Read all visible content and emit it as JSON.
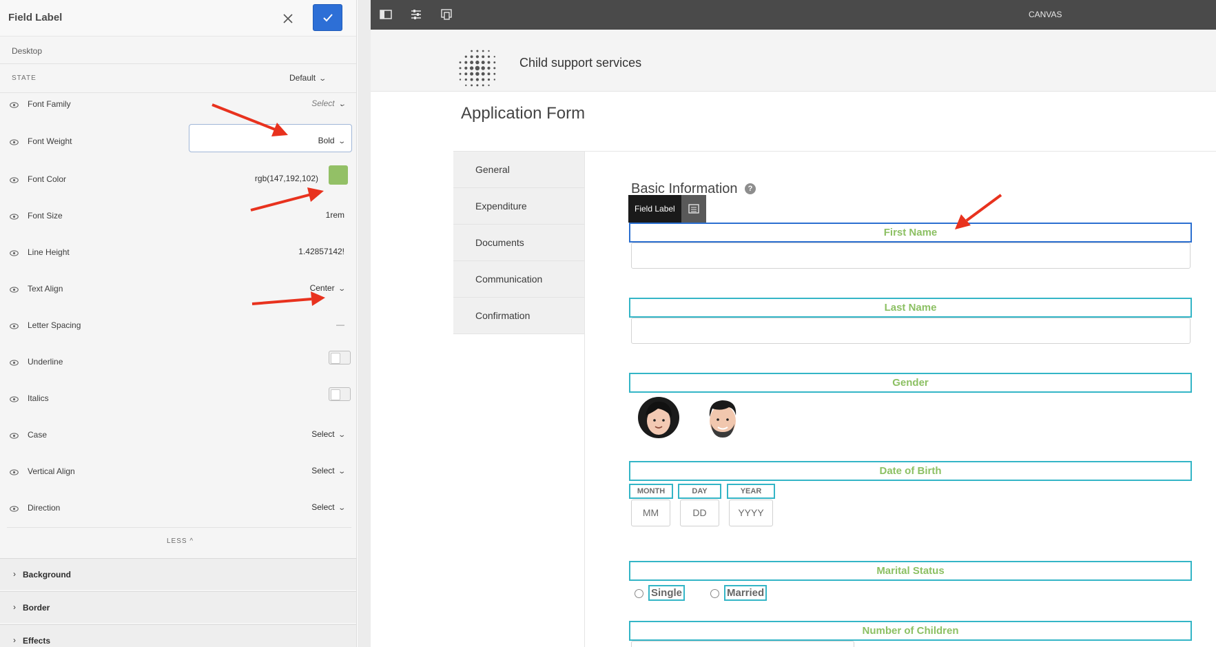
{
  "panel": {
    "title": "Field Label",
    "device": "Desktop",
    "state_label": "STATE",
    "state_value": "Default",
    "properties": [
      {
        "label": "Font Family",
        "value": "Select"
      },
      {
        "label": "Font Weight",
        "value": "Bold"
      },
      {
        "label": "Font Color",
        "value": "rgb(147,192,102)"
      },
      {
        "label": "Font Size",
        "value": "1rem"
      },
      {
        "label": "Line Height",
        "value": "1.42857142!"
      },
      {
        "label": "Text Align",
        "value": "Center"
      },
      {
        "label": "Letter Spacing",
        "value": "—"
      },
      {
        "label": "Underline",
        "value": ""
      },
      {
        "label": "Italics",
        "value": ""
      },
      {
        "label": "Case",
        "value": "Select"
      },
      {
        "label": "Vertical Align",
        "value": "Select"
      },
      {
        "label": "Direction",
        "value": "Select"
      }
    ],
    "less_label": "LESS ^",
    "sections": [
      {
        "label": "Background"
      },
      {
        "label": "Border"
      },
      {
        "label": "Effects"
      }
    ]
  },
  "colors": {
    "font_color_swatch": "#93c066",
    "label_text": "#8cc063",
    "label_border": "#33b5c6",
    "accent_blue": "#2d6fd6"
  },
  "topbar": {
    "canvas_label": "CANVAS"
  },
  "site": {
    "title": "Child support services"
  },
  "form": {
    "title": "Application Form",
    "tabs": [
      {
        "label": "General"
      },
      {
        "label": "Expenditure"
      },
      {
        "label": "Documents"
      },
      {
        "label": "Communication"
      },
      {
        "label": "Confirmation"
      }
    ],
    "section_title": "Basic Information",
    "toolbar_tag": "Field Label",
    "fields": {
      "first_name": "First Name",
      "last_name": "Last Name",
      "gender": "Gender",
      "dob": "Date of Birth",
      "dob_parts": [
        {
          "label": "MONTH",
          "placeholder": "MM"
        },
        {
          "label": "DAY",
          "placeholder": "DD"
        },
        {
          "label": "YEAR",
          "placeholder": "YYYY"
        }
      ],
      "marital_status": "Marital Status",
      "marital_options": [
        "Single",
        "Married"
      ],
      "num_children": "Number of Children"
    }
  }
}
